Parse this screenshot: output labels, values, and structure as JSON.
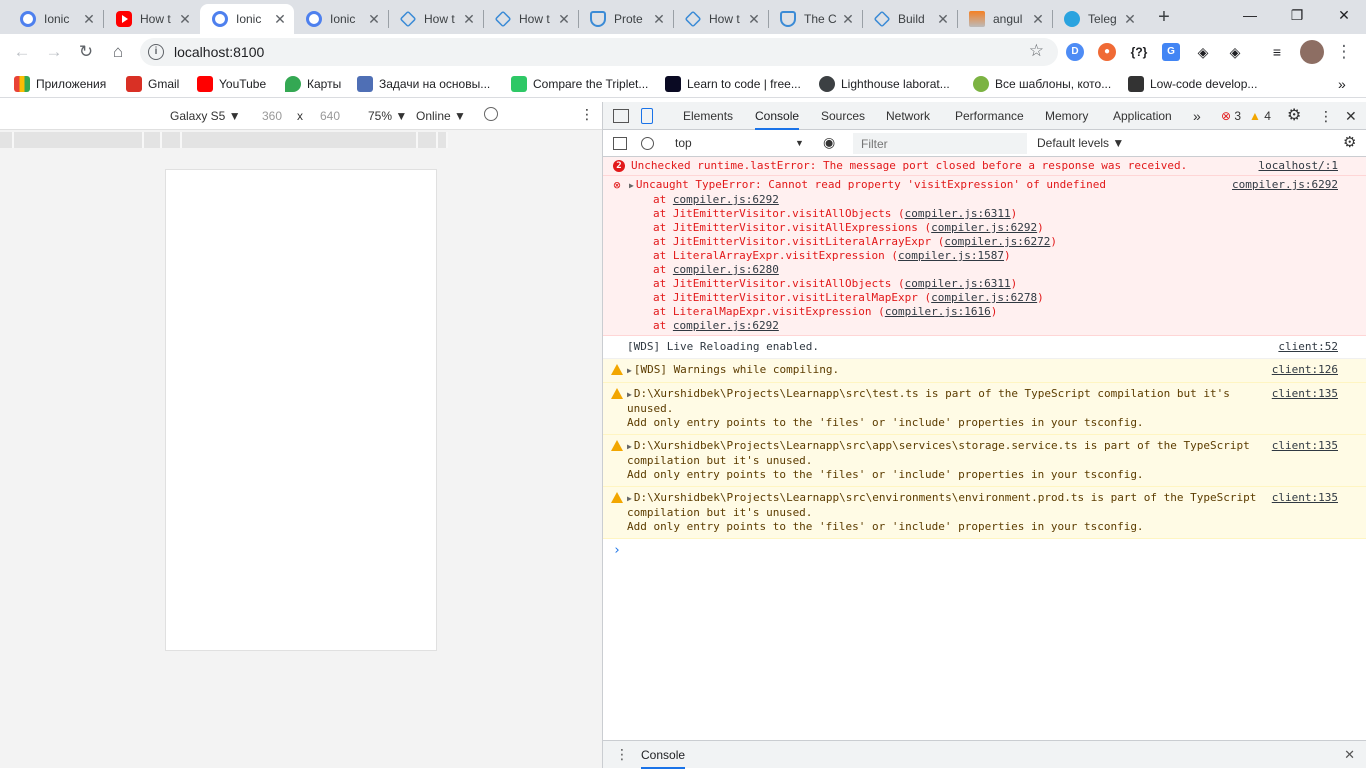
{
  "browser": {
    "tabs": [
      {
        "title": "Ionic",
        "icon": "ionic-icon",
        "active": false
      },
      {
        "title": "How t",
        "icon": "youtube-icon",
        "active": false
      },
      {
        "title": "Ionic",
        "icon": "ionic-icon",
        "active": true
      },
      {
        "title": "Ionic",
        "icon": "ionic-icon",
        "active": false
      },
      {
        "title": "How t",
        "icon": "cube-icon",
        "active": false
      },
      {
        "title": "How t",
        "icon": "cube-icon",
        "active": false
      },
      {
        "title": "Prote",
        "icon": "shield-icon",
        "active": false
      },
      {
        "title": "How t",
        "icon": "cube-icon",
        "active": false
      },
      {
        "title": "The C",
        "icon": "shield-icon",
        "active": false
      },
      {
        "title": "Build",
        "icon": "cube-icon",
        "active": false
      },
      {
        "title": "angul",
        "icon": "stackoverflow-icon",
        "active": false
      },
      {
        "title": "Teleg",
        "icon": "telegram-icon",
        "active": false
      }
    ],
    "new_tab": "+",
    "window_controls": {
      "minimize": "—",
      "maximize": "❐",
      "close": "✕"
    },
    "url": "localhost:8100",
    "extensions": [
      "D",
      "●",
      "{?}",
      "G",
      "◈",
      "◈",
      "≡"
    ],
    "bookmarks": [
      {
        "label": "Приложения",
        "color": "#e94235"
      },
      {
        "label": "Gmail",
        "color": "#d93025"
      },
      {
        "label": "YouTube",
        "color": "#ff0000"
      },
      {
        "label": "Карты",
        "color": "#34a853"
      },
      {
        "label": "Задачи на основы...",
        "color": "#4f6fb5"
      },
      {
        "label": "Compare the Triplet...",
        "color": "#2ec866"
      },
      {
        "label": "Learn to code | free...",
        "color": "#0a0a23"
      },
      {
        "label": "Lighthouse laborat...",
        "color": "#3c4043"
      },
      {
        "label": "Все шаблоны, кото...",
        "color": "#7cb342"
      },
      {
        "label": "Low-code develop...",
        "color": "#333333"
      }
    ],
    "bookmarks_more": "»"
  },
  "device_toolbar": {
    "device": "Galaxy S5 ▼",
    "width": "360",
    "times": "x",
    "height": "640",
    "zoom": "75% ▼",
    "network": "Online ▼",
    "more": "⋮"
  },
  "devtools": {
    "tabs": [
      "Elements",
      "Console",
      "Sources",
      "Network",
      "Performance",
      "Memory",
      "Application"
    ],
    "active_tab": "Console",
    "more_tabs": "»",
    "error_count": "3",
    "warning_count": "4",
    "context": "top",
    "filter_placeholder": "Filter",
    "levels": "Default levels ▼",
    "drawer_tab": "Console"
  },
  "console": {
    "msg1": {
      "count": "2",
      "text": "Unchecked runtime.lastError: The message port closed before a response was received.",
      "source": "localhost/:1"
    },
    "msg2": {
      "text": "Uncaught TypeError: Cannot read property 'visitExpression' of undefined",
      "source": "compiler.js:6292",
      "stack": [
        {
          "fn": "",
          "loc": "compiler.js:6292"
        },
        {
          "fn": "JitEmitterVisitor.visitAllObjects",
          "loc": "compiler.js:6311"
        },
        {
          "fn": "JitEmitterVisitor.visitAllExpressions",
          "loc": "compiler.js:6292"
        },
        {
          "fn": "JitEmitterVisitor.visitLiteralArrayExpr",
          "loc": "compiler.js:6272"
        },
        {
          "fn": "LiteralArrayExpr.visitExpression",
          "loc": "compiler.js:1587"
        },
        {
          "fn": "",
          "loc": "compiler.js:6280"
        },
        {
          "fn": "JitEmitterVisitor.visitAllObjects",
          "loc": "compiler.js:6311"
        },
        {
          "fn": "JitEmitterVisitor.visitLiteralMapExpr",
          "loc": "compiler.js:6278"
        },
        {
          "fn": "LiteralMapExpr.visitExpression",
          "loc": "compiler.js:1616"
        },
        {
          "fn": "",
          "loc": "compiler.js:6292"
        }
      ]
    },
    "msg3": {
      "text": "[WDS] Live Reloading enabled.",
      "source": "client:52"
    },
    "msg4": {
      "text": "[WDS] Warnings while compiling.",
      "source": "client:126"
    },
    "msg5": {
      "line1": "D:\\Xurshidbek\\Projects\\Learnapp\\src\\test.ts is part of the TypeScript compilation but it's",
      "line2": "unused.",
      "line3": "Add only entry points to the 'files' or 'include' properties in your tsconfig.",
      "source": "client:135"
    },
    "msg6": {
      "line1": "D:\\Xurshidbek\\Projects\\Learnapp\\src\\app\\services\\storage.service.ts is part of the TypeScript",
      "line2": "compilation but it's unused.",
      "line3": "Add only entry points to the 'files' or 'include' properties in your tsconfig.",
      "source": "client:135"
    },
    "msg7": {
      "line1": "D:\\Xurshidbek\\Projects\\Learnapp\\src\\environments\\environment.prod.ts is part of the TypeScript",
      "line2": "compilation but it's unused.",
      "line3": "Add only entry points to the 'files' or 'include' properties in your tsconfig.",
      "source": "client:135"
    },
    "prompt": "›"
  }
}
